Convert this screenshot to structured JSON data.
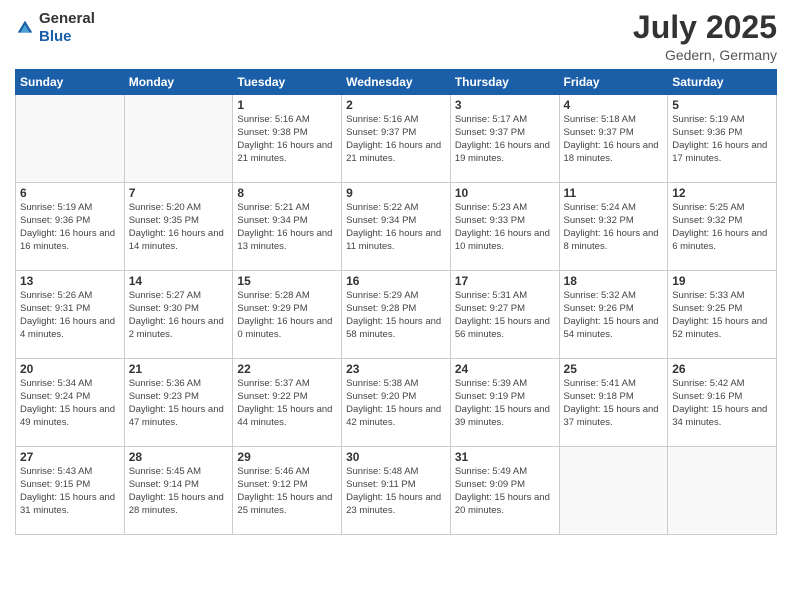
{
  "logo": {
    "general": "General",
    "blue": "Blue"
  },
  "header": {
    "month": "July 2025",
    "location": "Gedern, Germany"
  },
  "weekdays": [
    "Sunday",
    "Monday",
    "Tuesday",
    "Wednesday",
    "Thursday",
    "Friday",
    "Saturday"
  ],
  "weeks": [
    [
      {
        "day": "",
        "sunrise": "",
        "sunset": "",
        "daylight": ""
      },
      {
        "day": "",
        "sunrise": "",
        "sunset": "",
        "daylight": ""
      },
      {
        "day": "1",
        "sunrise": "Sunrise: 5:16 AM",
        "sunset": "Sunset: 9:38 PM",
        "daylight": "Daylight: 16 hours and 21 minutes."
      },
      {
        "day": "2",
        "sunrise": "Sunrise: 5:16 AM",
        "sunset": "Sunset: 9:37 PM",
        "daylight": "Daylight: 16 hours and 21 minutes."
      },
      {
        "day": "3",
        "sunrise": "Sunrise: 5:17 AM",
        "sunset": "Sunset: 9:37 PM",
        "daylight": "Daylight: 16 hours and 19 minutes."
      },
      {
        "day": "4",
        "sunrise": "Sunrise: 5:18 AM",
        "sunset": "Sunset: 9:37 PM",
        "daylight": "Daylight: 16 hours and 18 minutes."
      },
      {
        "day": "5",
        "sunrise": "Sunrise: 5:19 AM",
        "sunset": "Sunset: 9:36 PM",
        "daylight": "Daylight: 16 hours and 17 minutes."
      }
    ],
    [
      {
        "day": "6",
        "sunrise": "Sunrise: 5:19 AM",
        "sunset": "Sunset: 9:36 PM",
        "daylight": "Daylight: 16 hours and 16 minutes."
      },
      {
        "day": "7",
        "sunrise": "Sunrise: 5:20 AM",
        "sunset": "Sunset: 9:35 PM",
        "daylight": "Daylight: 16 hours and 14 minutes."
      },
      {
        "day": "8",
        "sunrise": "Sunrise: 5:21 AM",
        "sunset": "Sunset: 9:34 PM",
        "daylight": "Daylight: 16 hours and 13 minutes."
      },
      {
        "day": "9",
        "sunrise": "Sunrise: 5:22 AM",
        "sunset": "Sunset: 9:34 PM",
        "daylight": "Daylight: 16 hours and 11 minutes."
      },
      {
        "day": "10",
        "sunrise": "Sunrise: 5:23 AM",
        "sunset": "Sunset: 9:33 PM",
        "daylight": "Daylight: 16 hours and 10 minutes."
      },
      {
        "day": "11",
        "sunrise": "Sunrise: 5:24 AM",
        "sunset": "Sunset: 9:32 PM",
        "daylight": "Daylight: 16 hours and 8 minutes."
      },
      {
        "day": "12",
        "sunrise": "Sunrise: 5:25 AM",
        "sunset": "Sunset: 9:32 PM",
        "daylight": "Daylight: 16 hours and 6 minutes."
      }
    ],
    [
      {
        "day": "13",
        "sunrise": "Sunrise: 5:26 AM",
        "sunset": "Sunset: 9:31 PM",
        "daylight": "Daylight: 16 hours and 4 minutes."
      },
      {
        "day": "14",
        "sunrise": "Sunrise: 5:27 AM",
        "sunset": "Sunset: 9:30 PM",
        "daylight": "Daylight: 16 hours and 2 minutes."
      },
      {
        "day": "15",
        "sunrise": "Sunrise: 5:28 AM",
        "sunset": "Sunset: 9:29 PM",
        "daylight": "Daylight: 16 hours and 0 minutes."
      },
      {
        "day": "16",
        "sunrise": "Sunrise: 5:29 AM",
        "sunset": "Sunset: 9:28 PM",
        "daylight": "Daylight: 15 hours and 58 minutes."
      },
      {
        "day": "17",
        "sunrise": "Sunrise: 5:31 AM",
        "sunset": "Sunset: 9:27 PM",
        "daylight": "Daylight: 15 hours and 56 minutes."
      },
      {
        "day": "18",
        "sunrise": "Sunrise: 5:32 AM",
        "sunset": "Sunset: 9:26 PM",
        "daylight": "Daylight: 15 hours and 54 minutes."
      },
      {
        "day": "19",
        "sunrise": "Sunrise: 5:33 AM",
        "sunset": "Sunset: 9:25 PM",
        "daylight": "Daylight: 15 hours and 52 minutes."
      }
    ],
    [
      {
        "day": "20",
        "sunrise": "Sunrise: 5:34 AM",
        "sunset": "Sunset: 9:24 PM",
        "daylight": "Daylight: 15 hours and 49 minutes."
      },
      {
        "day": "21",
        "sunrise": "Sunrise: 5:36 AM",
        "sunset": "Sunset: 9:23 PM",
        "daylight": "Daylight: 15 hours and 47 minutes."
      },
      {
        "day": "22",
        "sunrise": "Sunrise: 5:37 AM",
        "sunset": "Sunset: 9:22 PM",
        "daylight": "Daylight: 15 hours and 44 minutes."
      },
      {
        "day": "23",
        "sunrise": "Sunrise: 5:38 AM",
        "sunset": "Sunset: 9:20 PM",
        "daylight": "Daylight: 15 hours and 42 minutes."
      },
      {
        "day": "24",
        "sunrise": "Sunrise: 5:39 AM",
        "sunset": "Sunset: 9:19 PM",
        "daylight": "Daylight: 15 hours and 39 minutes."
      },
      {
        "day": "25",
        "sunrise": "Sunrise: 5:41 AM",
        "sunset": "Sunset: 9:18 PM",
        "daylight": "Daylight: 15 hours and 37 minutes."
      },
      {
        "day": "26",
        "sunrise": "Sunrise: 5:42 AM",
        "sunset": "Sunset: 9:16 PM",
        "daylight": "Daylight: 15 hours and 34 minutes."
      }
    ],
    [
      {
        "day": "27",
        "sunrise": "Sunrise: 5:43 AM",
        "sunset": "Sunset: 9:15 PM",
        "daylight": "Daylight: 15 hours and 31 minutes."
      },
      {
        "day": "28",
        "sunrise": "Sunrise: 5:45 AM",
        "sunset": "Sunset: 9:14 PM",
        "daylight": "Daylight: 15 hours and 28 minutes."
      },
      {
        "day": "29",
        "sunrise": "Sunrise: 5:46 AM",
        "sunset": "Sunset: 9:12 PM",
        "daylight": "Daylight: 15 hours and 25 minutes."
      },
      {
        "day": "30",
        "sunrise": "Sunrise: 5:48 AM",
        "sunset": "Sunset: 9:11 PM",
        "daylight": "Daylight: 15 hours and 23 minutes."
      },
      {
        "day": "31",
        "sunrise": "Sunrise: 5:49 AM",
        "sunset": "Sunset: 9:09 PM",
        "daylight": "Daylight: 15 hours and 20 minutes."
      },
      {
        "day": "",
        "sunrise": "",
        "sunset": "",
        "daylight": ""
      },
      {
        "day": "",
        "sunrise": "",
        "sunset": "",
        "daylight": ""
      }
    ]
  ]
}
